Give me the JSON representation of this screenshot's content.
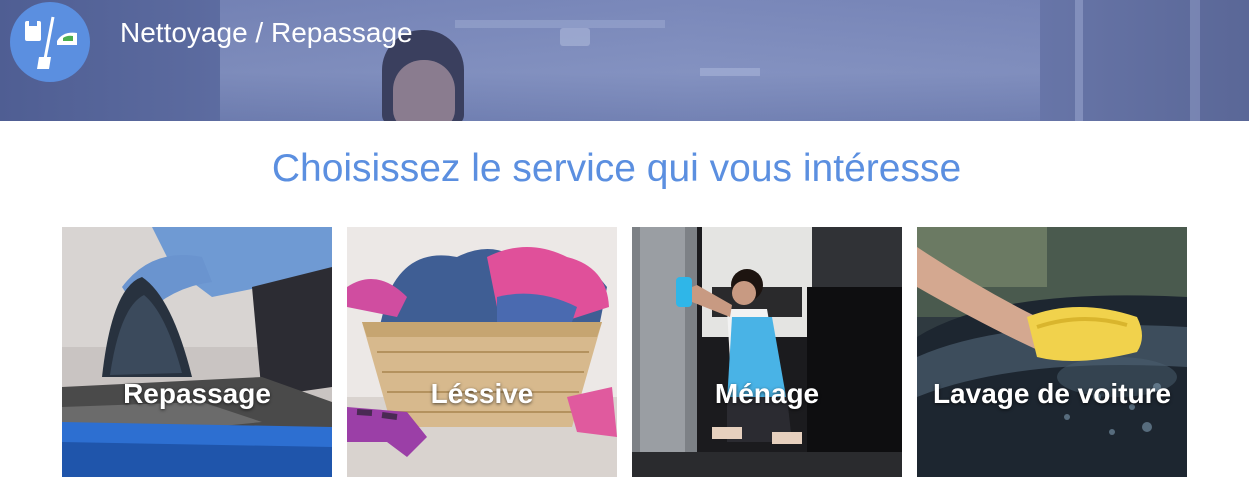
{
  "header": {
    "title": "Nettoyage / Repassage",
    "logo_icon": "broom-and-iron-icon"
  },
  "main": {
    "heading": "Choisissez le service qui vous intéresse",
    "accent_color": "#5b8fe0",
    "services": [
      {
        "label": "Repassage",
        "icon": "ironing-photo"
      },
      {
        "label": "Léssive",
        "icon": "laundry-basket-photo"
      },
      {
        "label": "Ménage",
        "icon": "cleaning-woman-photo"
      },
      {
        "label": "Lavage de voiture",
        "icon": "car-washing-photo"
      }
    ]
  }
}
